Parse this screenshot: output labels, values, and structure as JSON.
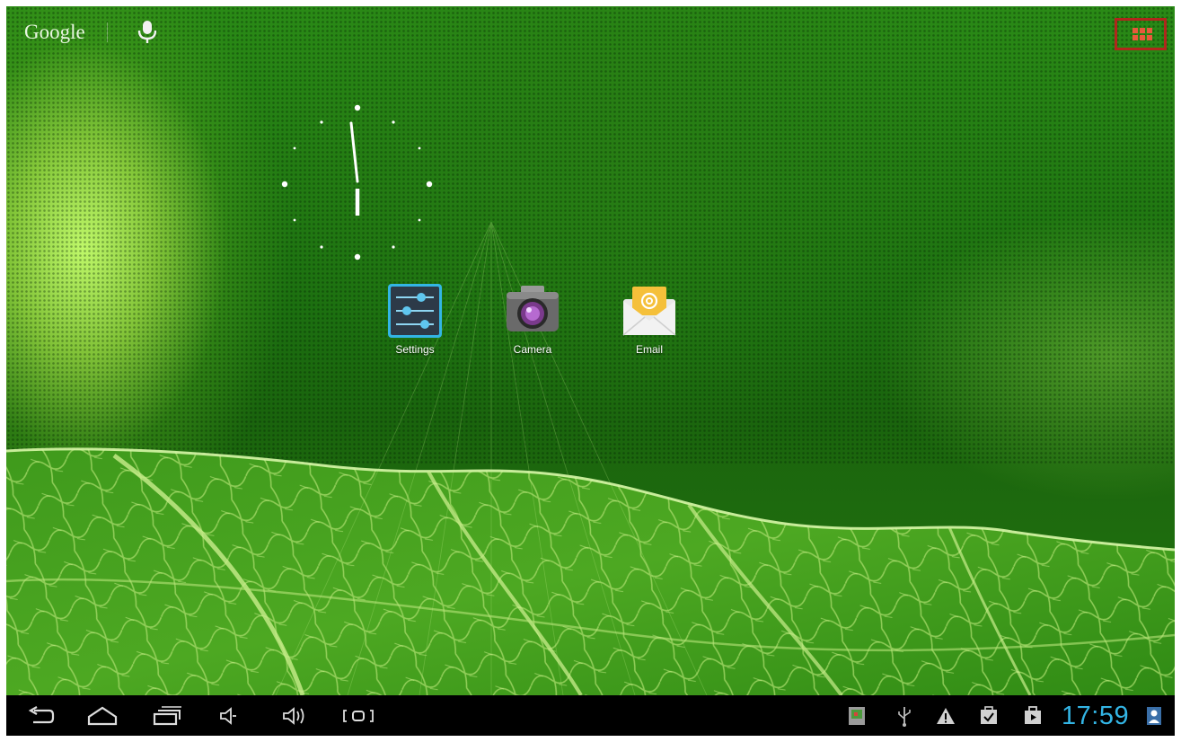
{
  "top_bar": {
    "google_search_label": "Google",
    "mic_icon": "microphone-icon",
    "apps_icon": "app-drawer-grid-icon",
    "apps_highlight_color": "#b0281c"
  },
  "clock_widget": {
    "icon": "analog-clock-icon"
  },
  "desktop_apps": [
    {
      "label": "Settings",
      "icon": "settings-sliders-icon"
    },
    {
      "label": "Camera",
      "icon": "camera-icon"
    },
    {
      "label": "Email",
      "icon": "email-envelope-icon"
    }
  ],
  "nav_bar": {
    "buttons": [
      {
        "icon": "back-icon"
      },
      {
        "icon": "home-icon"
      },
      {
        "icon": "recent-apps-icon"
      },
      {
        "icon": "volume-down-icon"
      },
      {
        "icon": "volume-up-icon"
      },
      {
        "icon": "screenshot-icon"
      }
    ],
    "tray": {
      "icons": [
        "gallery-notification-icon",
        "usb-icon",
        "warning-icon",
        "task-check-icon",
        "shopping-bag-icon",
        "user-icon"
      ],
      "time": "17:59",
      "time_color": "#33b5e5"
    }
  }
}
